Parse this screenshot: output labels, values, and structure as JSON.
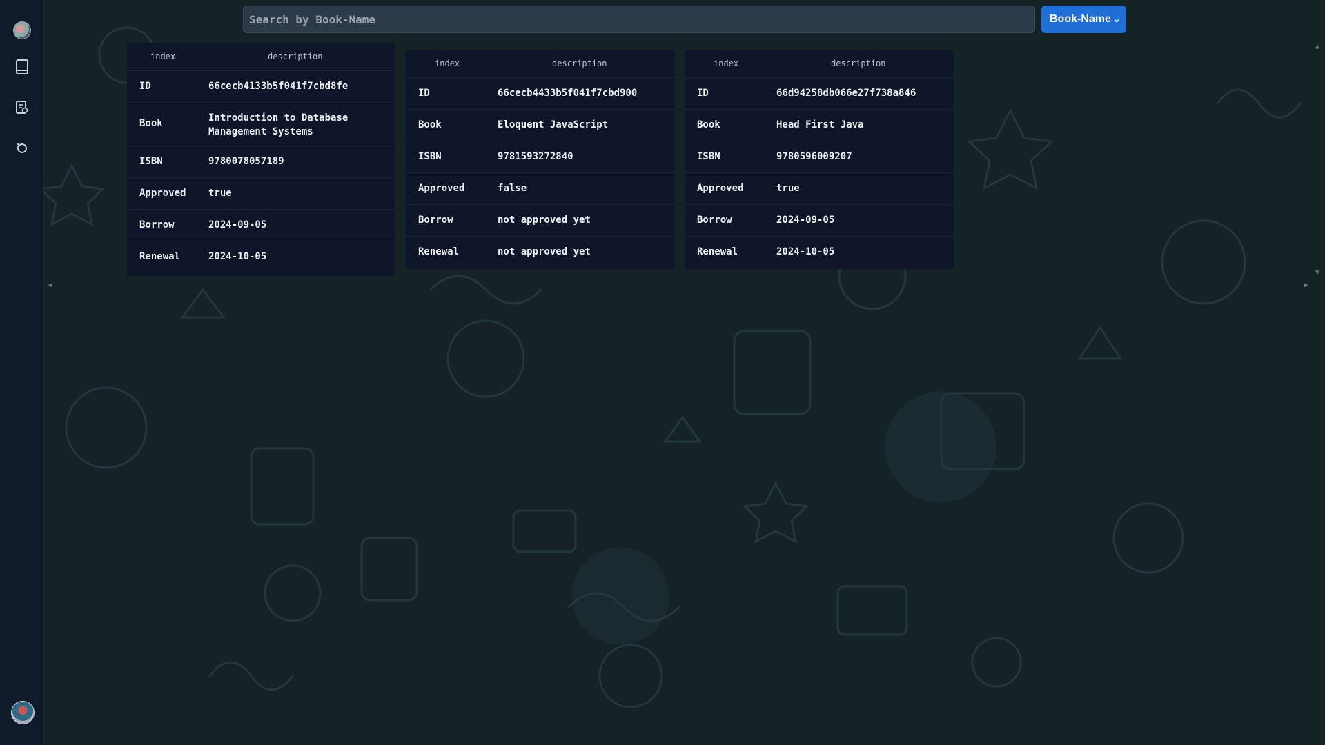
{
  "sidebar": {
    "items": [
      {
        "icon": "globe-avatar-icon"
      },
      {
        "icon": "book-icon"
      },
      {
        "icon": "receipt-icon"
      },
      {
        "icon": "refresh-icon"
      }
    ],
    "profile_icon": "user-avatar-icon"
  },
  "search": {
    "placeholder": "Search by Book-Name",
    "value": ""
  },
  "filter": {
    "selected": "Book-Name"
  },
  "colors": {
    "accent": "#1f6fd6",
    "card_bg": "#0f1629",
    "sidebar_bg": "#0f1a2b"
  },
  "cards": [
    {
      "header": {
        "index": "index",
        "description": "description"
      },
      "rows": [
        {
          "key": "ID",
          "value": "66cecb4133b5f041f7cbd8fe"
        },
        {
          "key": "Book",
          "value": "Introduction to Database Management Systems"
        },
        {
          "key": "ISBN",
          "value": "9780078057189"
        },
        {
          "key": "Approved",
          "value": "true"
        },
        {
          "key": "Borrow",
          "value": "2024-09-05"
        },
        {
          "key": "Renewal",
          "value": "2024-10-05"
        }
      ]
    },
    {
      "header": {
        "index": "index",
        "description": "description"
      },
      "rows": [
        {
          "key": "ID",
          "value": "66cecb4433b5f041f7cbd900"
        },
        {
          "key": "Book",
          "value": "Eloquent JavaScript"
        },
        {
          "key": "ISBN",
          "value": "9781593272840"
        },
        {
          "key": "Approved",
          "value": "false"
        },
        {
          "key": "Borrow",
          "value": "not approved yet"
        },
        {
          "key": "Renewal",
          "value": "not approved yet"
        }
      ]
    },
    {
      "header": {
        "index": "index",
        "description": "description"
      },
      "rows": [
        {
          "key": "ID",
          "value": "66d94258db066e27f738a846"
        },
        {
          "key": "Book",
          "value": "Head First Java"
        },
        {
          "key": "ISBN",
          "value": "9780596009207"
        },
        {
          "key": "Approved",
          "value": "true"
        },
        {
          "key": "Borrow",
          "value": "2024-09-05"
        },
        {
          "key": "Renewal",
          "value": "2024-10-05"
        }
      ]
    }
  ]
}
